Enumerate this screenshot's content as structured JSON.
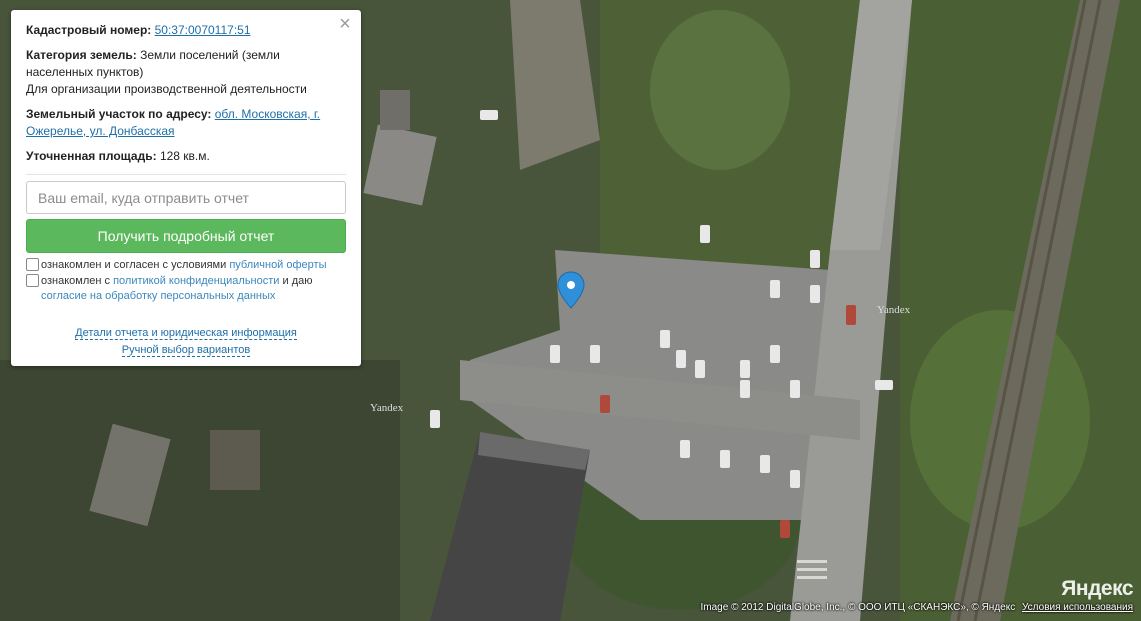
{
  "popup": {
    "close_glyph": "×",
    "cadastral_label": "Кадастровый номер:",
    "cadastral_number": "50:37:0070117:51",
    "category_label": "Категория земель:",
    "category_value": "Земли поселений (земли населенных пунктов)",
    "category_use": "Для организации производственной деятельности",
    "address_label": "Земельный участок по адресу:",
    "address_value": "обл. Московская, г. Ожерелье, ул. Донбасская",
    "area_label": "Уточненная площадь:",
    "area_value": "128 кв.м.",
    "email_placeholder": "Ваш email, куда отправить отчет",
    "submit_label": "Получить подробный отчет",
    "offer_text": "ознакомлен и согласен с условиями ",
    "offer_link": "публичной оферты",
    "privacy_text_1": "ознакомлен с ",
    "privacy_link": "политикой конфиденциальности",
    "privacy_text_2": " и даю ",
    "consent_link": "согласие на обработку персональных данных",
    "details_link": "Детали отчета и юридическая информация",
    "manual_link": "Ручной выбор вариантов"
  },
  "map": {
    "watermark_1": "Yandex",
    "watermark_2": "Yandex",
    "logo": "Яндекс",
    "copyright": "Image © 2012 DigitalGlobe, Inc., © ООО ИТЦ «СКАНЭКС», © Яндекс",
    "terms": "Условия использования",
    "pin_color": "#2f8fd8",
    "button_color": "#5cb85c",
    "link_color": "#1e6fa8"
  }
}
